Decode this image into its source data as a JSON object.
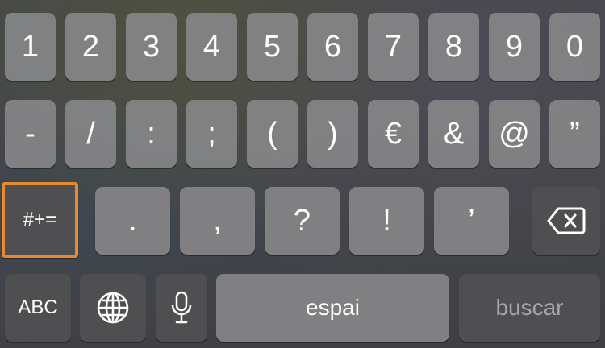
{
  "keyboard": {
    "row1": [
      "1",
      "2",
      "3",
      "4",
      "5",
      "6",
      "7",
      "8",
      "9",
      "0"
    ],
    "row2": [
      "-",
      "/",
      ":",
      ";",
      "(",
      ")",
      "€",
      "&",
      "@",
      "”"
    ],
    "row3": {
      "toggle_label": "#+=",
      "keys": [
        ".",
        ",",
        "?",
        "!",
        "’"
      ]
    },
    "row4": {
      "abc_label": "ABC",
      "space_label": "espai",
      "return_label": "buscar"
    }
  },
  "icons": {
    "globe": "globe-icon",
    "mic": "microphone-icon",
    "delete": "backspace-icon"
  },
  "colors": {
    "highlight": "#e8892f",
    "key_light": "#868688",
    "key_dark": "#505052"
  }
}
